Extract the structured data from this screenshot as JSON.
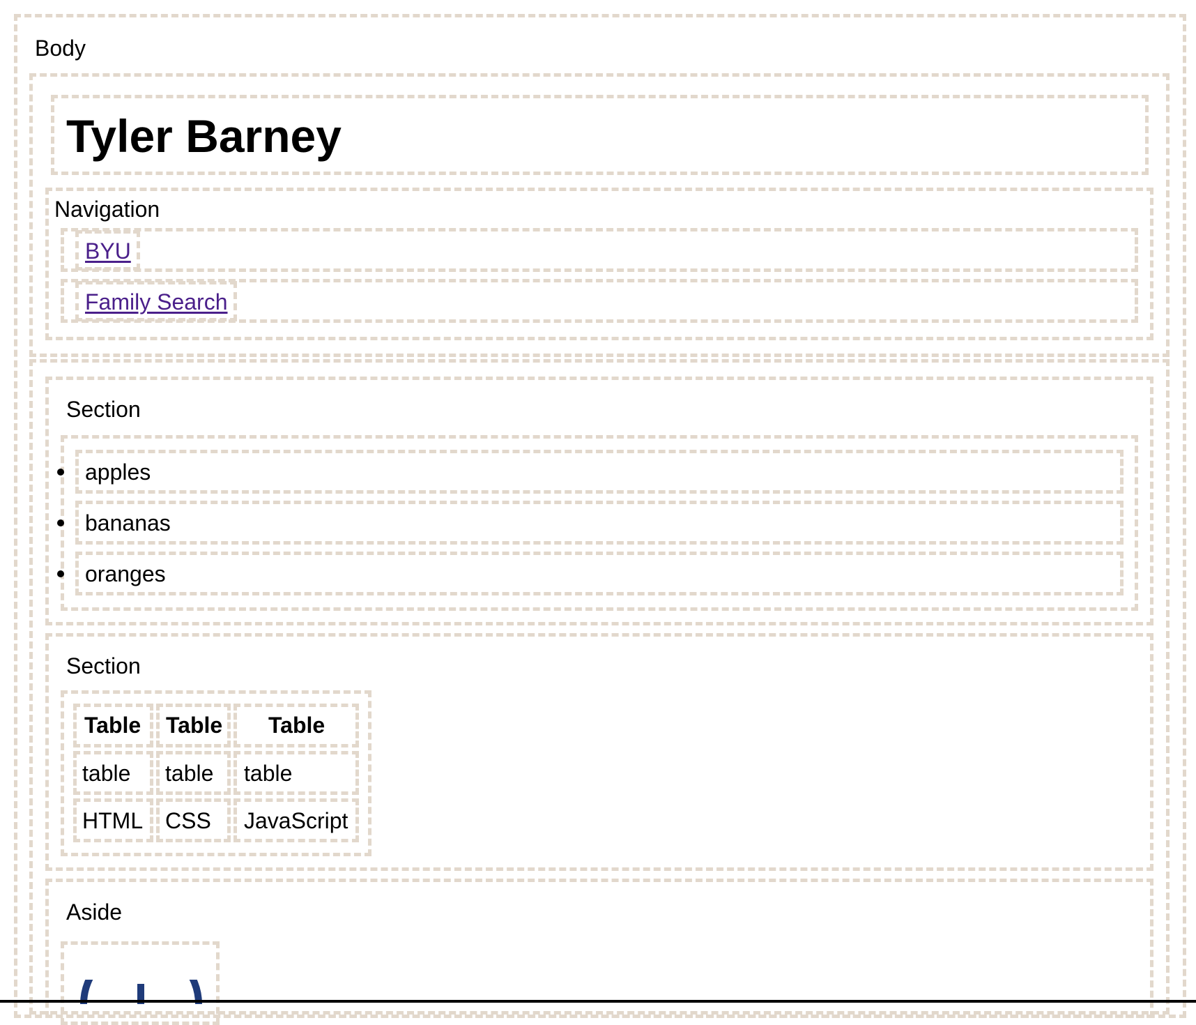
{
  "body_label": "Body",
  "header": {
    "title": "Tyler Barney"
  },
  "nav": {
    "label": "Navigation",
    "links": [
      {
        "label": "BYU"
      },
      {
        "label": "Family Search"
      }
    ]
  },
  "section_list": {
    "label": "Section",
    "items": [
      "apples",
      "bananas",
      "oranges"
    ]
  },
  "section_table": {
    "label": "Section",
    "headers": [
      "Table",
      "Table",
      "Table"
    ],
    "rows": [
      [
        "table",
        "table",
        "table"
      ],
      [
        "HTML",
        "CSS",
        "JavaScript"
      ]
    ]
  },
  "aside": {
    "label": "Aside",
    "image_icon": "byu-logo"
  },
  "colors": {
    "border": "#e2d8cc",
    "link": "#4a1f8a",
    "logo": "#1f3b7a"
  }
}
